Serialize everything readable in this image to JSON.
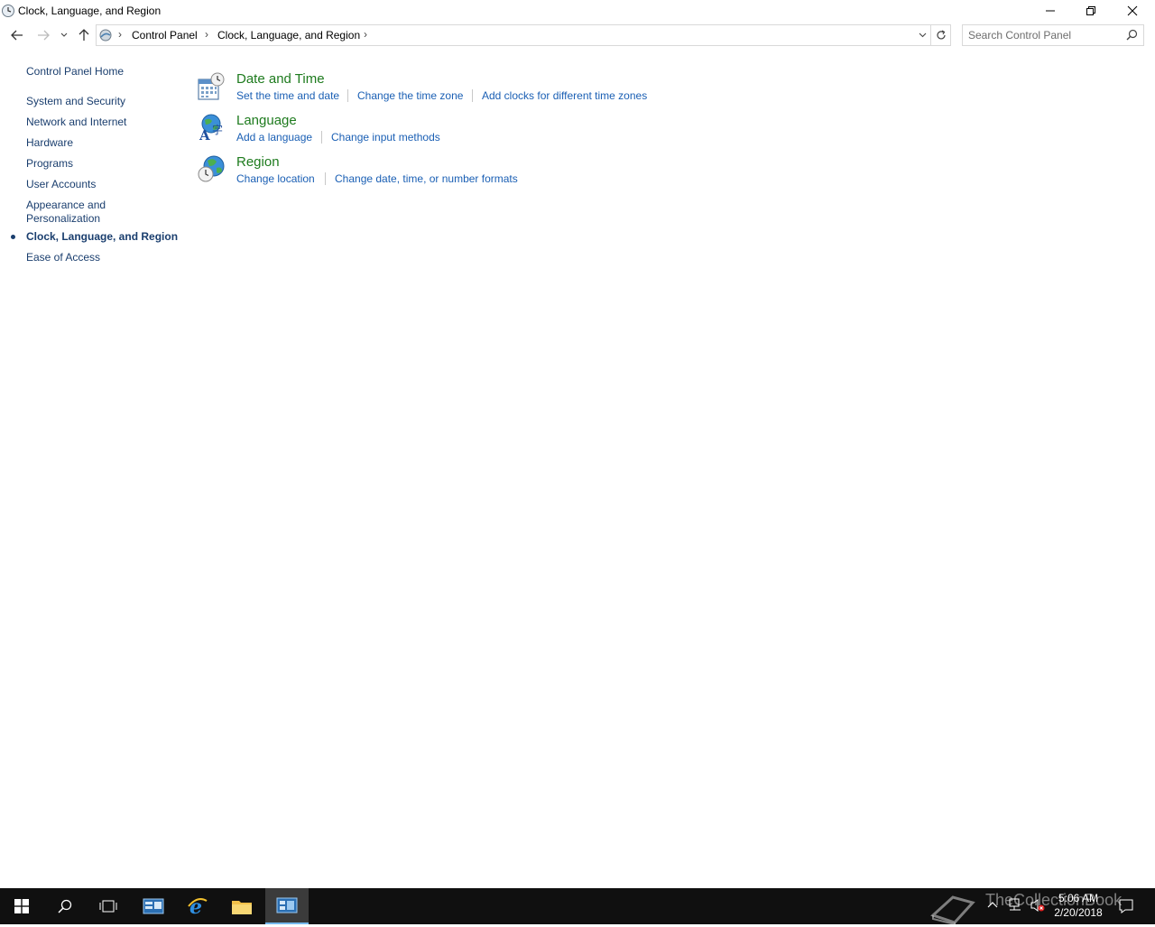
{
  "window": {
    "title": "Clock, Language, and Region"
  },
  "address": {
    "crumbs": [
      "Control Panel",
      "Clock, Language, and Region"
    ]
  },
  "search": {
    "placeholder": "Search Control Panel"
  },
  "leftnav": {
    "home": "Control Panel Home",
    "items": [
      "System and Security",
      "Network and Internet",
      "Hardware",
      "Programs",
      "User Accounts",
      "Appearance and",
      "Personalization",
      "Clock, Language, and Region",
      "Ease of Access"
    ]
  },
  "categories": [
    {
      "title": "Date and Time",
      "links": [
        "Set the time and date",
        "Change the time zone",
        "Add clocks for different time zones"
      ]
    },
    {
      "title": "Language",
      "links": [
        "Add a language",
        "Change input methods"
      ]
    },
    {
      "title": "Region",
      "links": [
        "Change location",
        "Change date, time, or number formats"
      ]
    }
  ],
  "taskbar": {
    "time": "5:06 AM",
    "date": "2/20/2018",
    "watermark": "TheCollectionBook"
  },
  "colors": {
    "link": "#1a5fb4",
    "category_title": "#1e7b1e",
    "nav_text": "#1a3e6e",
    "taskbar": "#101010"
  }
}
